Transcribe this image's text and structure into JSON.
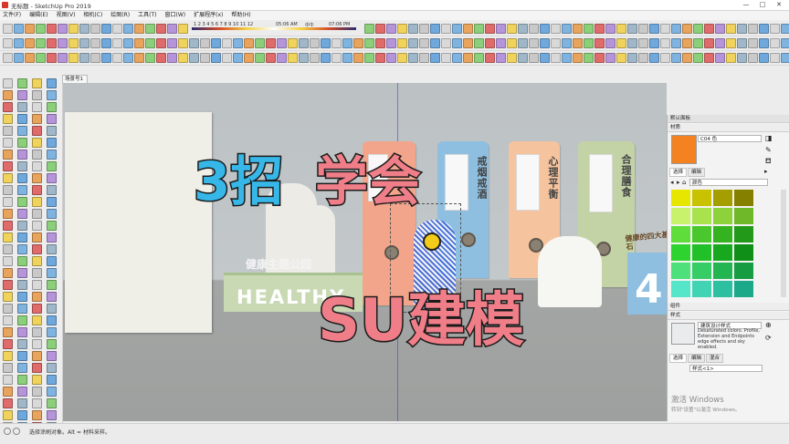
{
  "window": {
    "title": "无标题 - SketchUp Pro 2019",
    "minimize": "—",
    "maximize": "□",
    "close": "✕"
  },
  "menu": [
    "文件(F)",
    "编辑(E)",
    "视图(V)",
    "相机(C)",
    "绘图(R)",
    "工具(T)",
    "窗口(W)",
    "扩展程序(x)",
    "帮助(H)"
  ],
  "shadow_bar": {
    "months": "1 2 3 4 5 6 7 8 9 10 11 12",
    "start_time": "05:06 AM",
    "noon": "中午",
    "end_time": "07:06 PM"
  },
  "scene_tab": "场景号1",
  "model": {
    "boards": [
      {
        "text": "戒烟戒酒"
      },
      {
        "text": "心理平衡"
      },
      {
        "text": "合理膳食"
      }
    ],
    "sign_small": "健康主题公园",
    "sign_big": "HEALTHY",
    "corner_label": "健康的四大基石",
    "corner_number": "4"
  },
  "overlay": {
    "part1": "3招",
    "part2": "学会",
    "part3": "SU建模",
    "color1": "#36b7e8",
    "color2": "#f07e88"
  },
  "tray": {
    "title": "默认面板",
    "materials_section": "材质",
    "material_name": "C04 色",
    "tab_select": "选择",
    "tab_edit": "编辑",
    "collection": "颜色",
    "components_section": "组件",
    "styles_section": "样式",
    "style_name": "建筑设计样式",
    "style_desc": "Desaturated colors. Profile, Extension and Endpoints edge effects and sky enabled.",
    "style_tab_select": "选择",
    "style_tab_edit": "编辑",
    "style_tab_mix": "混合",
    "style_dropdown": "样式<1>",
    "current_color": "#f58220",
    "swatches": [
      "#e6e600",
      "#c9c200",
      "#a59e00",
      "#858000",
      "#c9f26c",
      "#a8e34d",
      "#8dd13b",
      "#6fb82a",
      "#5fdd3a",
      "#49c72c",
      "#35b21f",
      "#23991a",
      "#2ed32f",
      "#21bf28",
      "#17a81f",
      "#0f8e18",
      "#4ee07a",
      "#36cc66",
      "#24b553",
      "#169c42",
      "#55e6c9",
      "#40d4b4",
      "#2cc0a0",
      "#1ca98a"
    ]
  },
  "watermark": {
    "line1": "激活 Windows",
    "line2": "转到\"设置\"以激活 Windows。"
  },
  "status": {
    "text": "选择涂刷对象。Alt = 材料采样。"
  }
}
